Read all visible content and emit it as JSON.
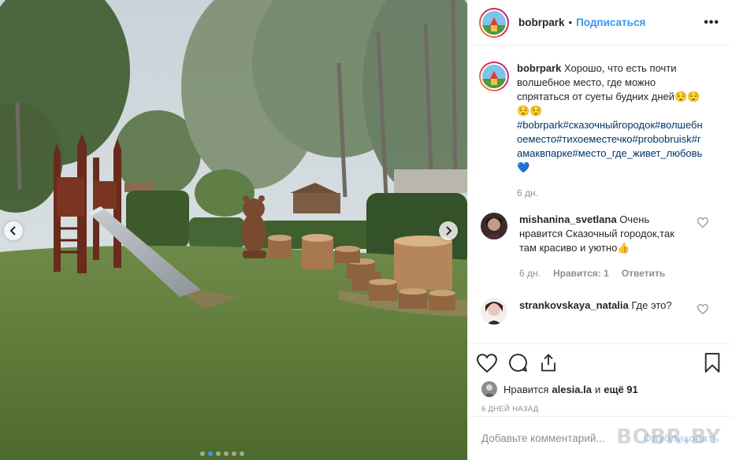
{
  "post": {
    "username": "bobrpark",
    "follow_label": "Подписаться",
    "more_label": "•••",
    "separator": "•"
  },
  "caption": {
    "username": "bobrpark",
    "text": "Хорошо, что есть почти волшебное место, где можно спрятаться от суеты будних дней😌😌😌😌",
    "hashtags": "#bobrpark#сказочныйгородок#волшебноеместо#тихоеместечко#probobruisk#гамаквпарке#место_где_живет_любовь💙",
    "time": "6 дн."
  },
  "comments": [
    {
      "username": "mishanina_svetlana",
      "text": "Очень нравится Сказочный городок,так там красиво и уютно👍",
      "time": "6 дн.",
      "likes": "Нравится: 1",
      "reply": "Ответить"
    },
    {
      "username": "strankovskaya_natalia",
      "text": "Где это?"
    }
  ],
  "likes": {
    "prefix": "Нравится",
    "user": "alesia.la",
    "middle": "и",
    "others": "ещё 91"
  },
  "posted_ago": "6 ДНЕЙ НАЗАД",
  "comment_box": {
    "placeholder": "Добавьте комментарий...",
    "publish_label": "Опубликовать"
  },
  "watermark": "BOBR.BY",
  "carousel": {
    "total_dots": 6,
    "active_index": 1
  },
  "icons": [
    "chevron-left-icon",
    "chevron-right-icon",
    "heart-icon",
    "comment-icon",
    "share-icon",
    "bookmark-icon",
    "more-icon"
  ],
  "colors": {
    "link": "#3897f0",
    "hashtag": "#003569",
    "muted": "#8e8e8e",
    "border": "#efefef"
  }
}
